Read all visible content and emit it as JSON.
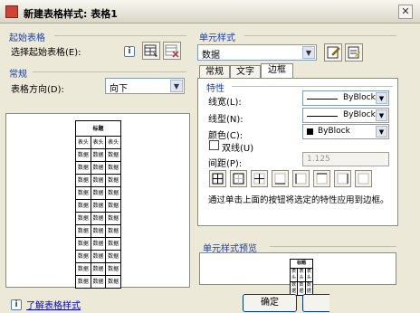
{
  "window": {
    "title": "新建表格样式: 表格1",
    "close_glyph": "✕"
  },
  "start_table": {
    "group_title": "起始表格",
    "select_label": "选择起始表格(E):",
    "info_glyph": "i"
  },
  "general": {
    "group_title": "常规",
    "direction_label": "表格方向(D):",
    "direction_value": "向下"
  },
  "preview": {
    "header_text": "标题",
    "col_header_text": "表头",
    "data_text": "数据"
  },
  "cell_style": {
    "group_title": "单元样式",
    "selected": "数据",
    "tabs": [
      {
        "label": "常规"
      },
      {
        "label": "文字"
      },
      {
        "label": "边框"
      }
    ],
    "active_tab": "边框"
  },
  "border_props": {
    "group_title": "特性",
    "lineweight_label": "线宽(L):",
    "lineweight_value": "ByBlock",
    "linetype_label": "线型(N):",
    "linetype_value": "ByBlock",
    "color_label": "颜色(C):",
    "color_value": "ByBlock",
    "double_line_label": "双线(U)",
    "spacing_label": "间距(P):",
    "spacing_value": "1.125",
    "hint": "通过单击上面的按钮将选定的特性应用到边框。"
  },
  "cell_preview": {
    "group_title": "单元样式预览"
  },
  "footer": {
    "help_link": "了解表格样式",
    "ok_label": "确定",
    "info_glyph": "i"
  }
}
